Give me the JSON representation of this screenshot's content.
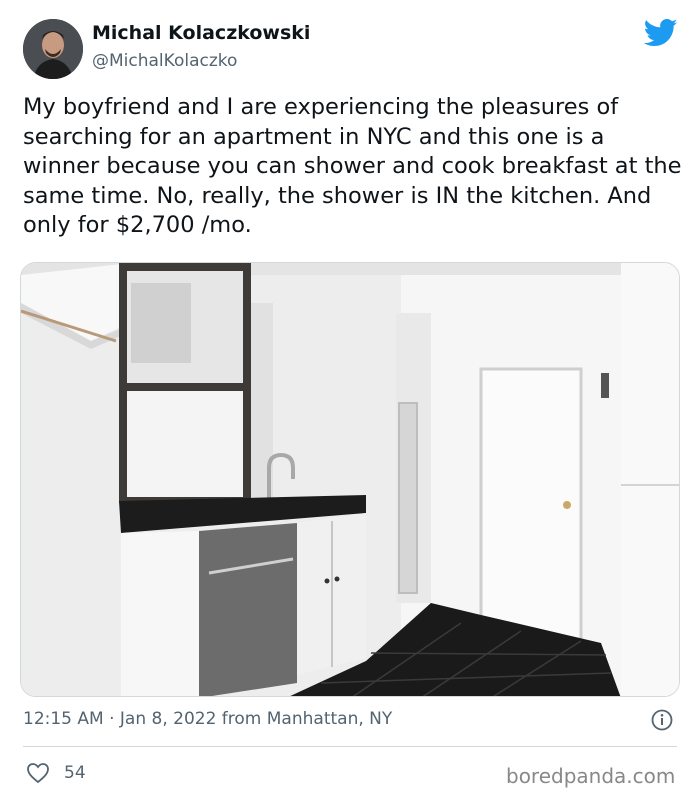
{
  "user": {
    "name": "Michal Kolaczkowski",
    "handle": "@MichalKolaczko",
    "avatar_icon": "profile-photo"
  },
  "brand": {
    "icon": "twitter-bird-icon",
    "color": "#1d9bf0"
  },
  "tweet": {
    "text": "My boyfriend and I are experiencing the pleasures of searching for an apartment in NYC and this one is a winner because you can shower and cook breakfast at the same time. No, really, the shower is IN the kitchen. And only for $2,700 /mo.",
    "timestamp": "12:15 AM · Jan 8, 2022 from Manhattan, NY",
    "likes": "54"
  },
  "watermark": "boredpanda.com"
}
